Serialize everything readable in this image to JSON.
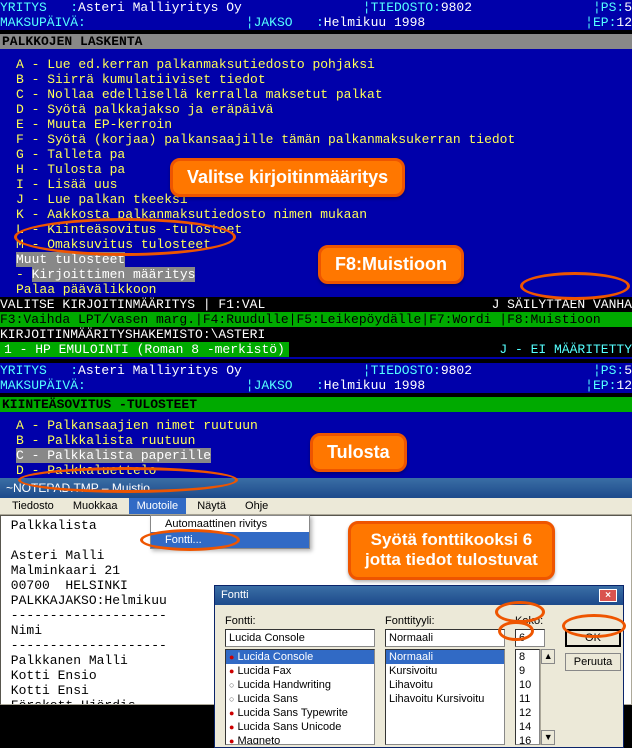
{
  "dos1": {
    "hdr": {
      "yritys_lbl": "YRITYS   :",
      "yritys_val": "Asteri Malliyritys Oy",
      "tiedosto_lbl": "¦TIEDOSTO:",
      "tiedosto_val": "9802",
      "ps_lbl": "¦PS:",
      "ps_val": "5",
      "maksu_lbl": "MAKSUPÄIVÄ:",
      "jakso_lbl": "¦JAKSO   :",
      "jakso_val": "Helmikuu 1998",
      "ep_lbl": "¦EP:",
      "ep_val": "12"
    },
    "title": "PALKKOJEN LASKENTA",
    "menu": [
      "A - Lue ed.kerran palkanmaksutiedosto pohjaksi",
      "B - Siirrä kumulatiiviset tiedot",
      "C - Nollaa edellisellä kerralla maksetut palkat",
      "D - Syötä palkkajakso ja eräpäivä",
      "E - Muuta EP-kerroin",
      "F - Syötä (korjaa) palkansaajille tämän palkanmaksukerran tiedot",
      "G - Talleta pa",
      "H - Tulosta pa",
      "I - Lisää uus",
      "J - Lue palkan                                         tkeeksi",
      "K - Aakkosta palkanmaksutiedosto nimen mukaan",
      "L - Kiinteäsovitus -tulosteet",
      "M - Omaksuvitus  tulosteet"
    ],
    "menu_n": "Muut tulosteet",
    "menu_hi": "Kirjoittimen määritys",
    "bottom": "Palaa  päävälikkoon",
    "stat1": "VALITSE KIRJOITINMÄÄRITYS  | F1:VAL",
    "stat1b": "J SÄILYTTÄEN VANHA",
    "stat2": "F3:Vaihda LPT/vasen marg.|F4:Ruudulle|F5:Leikepöydälle|F7:Wordi  |F8:Muistioon",
    "stat3a": "KIRJOITINMÄÄRITYSHAKEMISTO:\\ASTERI",
    "stat3b": "1 - HP EMULOINTI (Roman 8 -merkistö)",
    "stat3c": "J - EI MÄÄRITETTY"
  },
  "callouts": {
    "c1": "Valitse kirjoitinmääritys",
    "c2": "F8:Muistioon",
    "c3": "Tulosta",
    "c4a": "Syötä fonttikooksi 6",
    "c4b": "jotta tiedot tulostuvat"
  },
  "dos2": {
    "title": "KIINTEÄSOVITUS -TULOSTEET",
    "menu": [
      "A - Palkansaajien nimet ruutuun",
      "B - Palkkalista ruutuun"
    ],
    "menu_hi": "C - Palkkalista paperille",
    "menu_d": "D - Palkkaluettelo"
  },
  "notepad": {
    "title": "~NOTEPAD.TMP – Muistio",
    "menus": [
      "Tiedosto",
      "Muokkaa",
      "Muotoile",
      "Näytä",
      "Ohje"
    ],
    "dropdown": [
      "Automaattinen rivitys",
      "Fontti..."
    ],
    "content": " Palkkalista\n\n Asteri Malli\n Malminkaari 21\n 00700  HELSINKI\n PALKKAJAKSO:Helmikuu\n --------------------\n Nimi\n --------------------\n Palkkanen Malli\n Kotti Ensio\n Kotti Ensi\n Förskott Hjördis\n Virtanen Heri"
  },
  "fontdlg": {
    "title": "Fontti",
    "font_lbl": "Fontti:",
    "font_val": "Lucida Console",
    "fonts": [
      "Lucida Console",
      "Lucida Fax",
      "Lucida Handwriting",
      "Lucida Sans",
      "Lucida Sans Typewrite",
      "Lucida Sans Unicode",
      "Magneto"
    ],
    "style_lbl": "Fonttityyli:",
    "style_val": "Normaali",
    "styles": [
      "Normaali",
      "Kursivoitu",
      "Lihavoitu",
      "Lihavoitu Kursivoitu"
    ],
    "size_lbl": "Koko:",
    "size_val": "6",
    "sizes": [
      "8",
      "9",
      "10",
      "11",
      "12",
      "14",
      "16"
    ],
    "ok": "OK",
    "cancel": "Peruuta"
  }
}
